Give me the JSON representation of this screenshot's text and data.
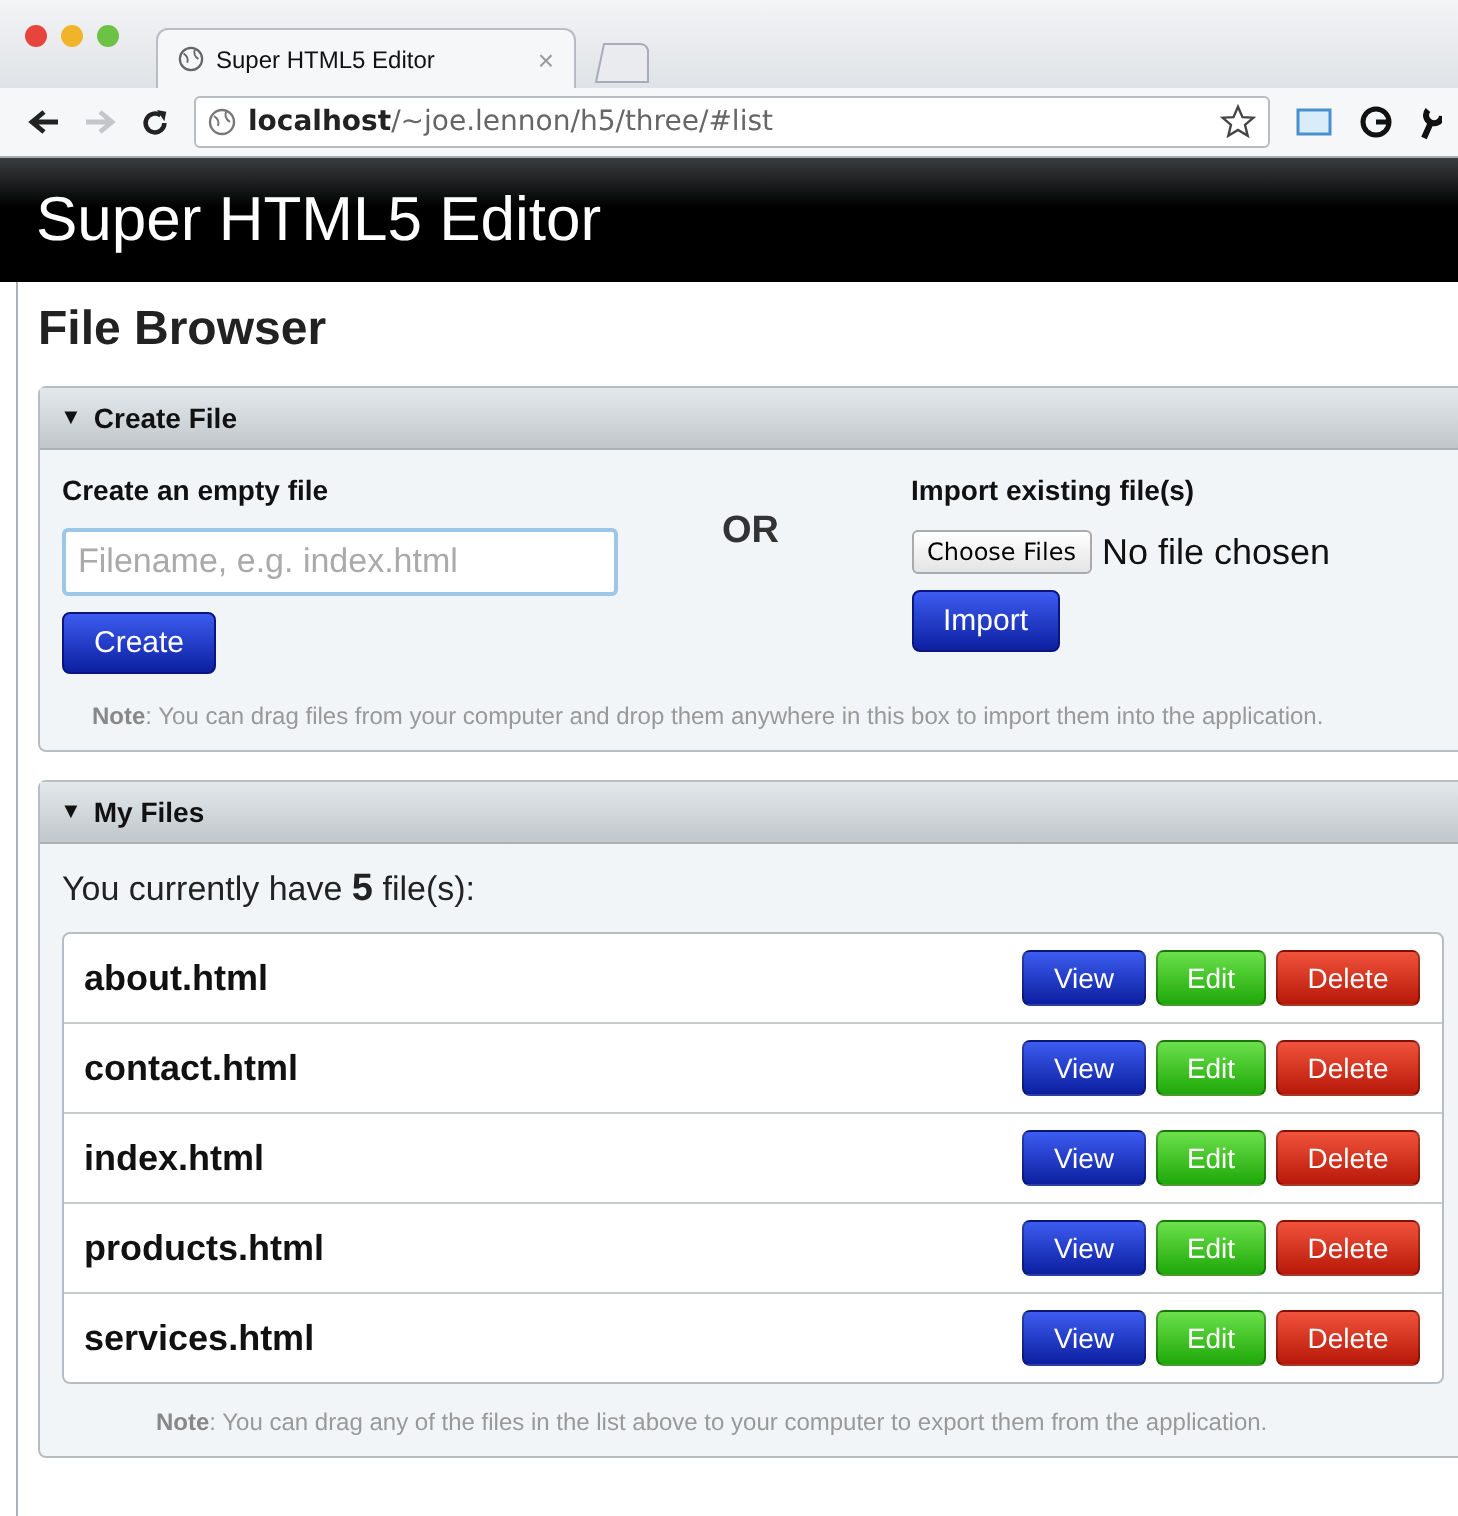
{
  "browser": {
    "tab": {
      "title": "Super HTML5 Editor",
      "close": "×"
    },
    "url": "**localhost**/~joe.lennon/h5/three/#list"
  },
  "app_header": {
    "title": "Super HTML5 Editor"
  },
  "page_title": "File Browser",
  "create_panel": {
    "toggle": "▼",
    "title": "Create File",
    "create": {
      "label": "Create an empty file",
      "placeholder": "Filename, e.g. index.html",
      "button": "Create"
    },
    "separator": "OR",
    "import": {
      "label": "Import existing file(s)",
      "choose_button": "Choose Files",
      "status": "No file chosen",
      "button": "Import"
    },
    "note": "**Note**: You can drag files from your computer and drop them anywhere in this box to import them into the application."
  },
  "files_panel": {
    "toggle": "▼",
    "title": "My Files",
    "count_text": "You currently have **5** file(s):",
    "files": [
      {
        "name": "about.html",
        "actions": [
          {
            "label": "View",
            "kind": "view"
          },
          {
            "label": "Edit",
            "kind": "edit"
          },
          {
            "label": "Delete",
            "kind": "delete"
          }
        ]
      },
      {
        "name": "contact.html",
        "actions": [
          {
            "label": "View",
            "kind": "view"
          },
          {
            "label": "Edit",
            "kind": "edit"
          },
          {
            "label": "Delete",
            "kind": "delete"
          }
        ]
      },
      {
        "name": "index.html",
        "actions": [
          {
            "label": "View",
            "kind": "view"
          },
          {
            "label": "Edit",
            "kind": "edit"
          },
          {
            "label": "Delete",
            "kind": "delete"
          }
        ]
      },
      {
        "name": "products.html",
        "actions": [
          {
            "label": "View",
            "kind": "view"
          },
          {
            "label": "Edit",
            "kind": "edit"
          },
          {
            "label": "Delete",
            "kind": "delete"
          }
        ]
      },
      {
        "name": "services.html",
        "actions": [
          {
            "label": "View",
            "kind": "view"
          },
          {
            "label": "Edit",
            "kind": "edit"
          },
          {
            "label": "Delete",
            "kind": "delete"
          }
        ]
      }
    ],
    "note": "**Note**: You can drag any of the files in the list above to your computer to export them from the application."
  }
}
